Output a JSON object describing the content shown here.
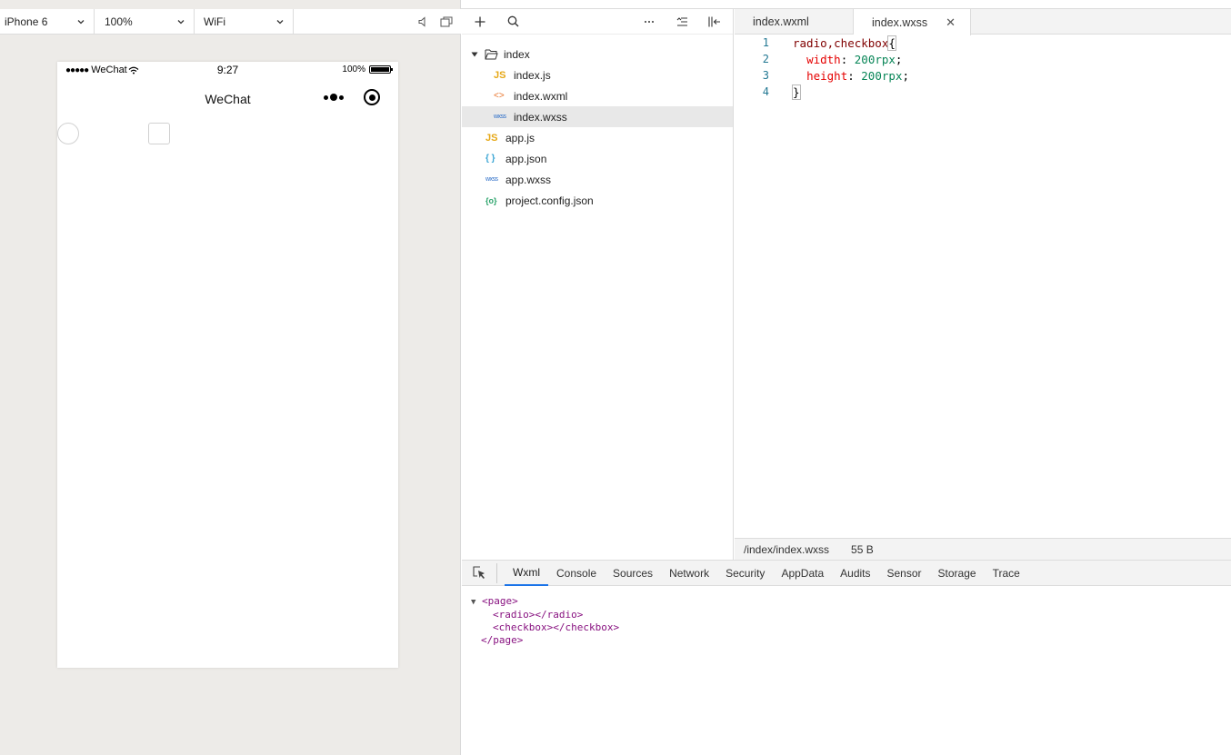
{
  "simulator": {
    "device": "iPhone 6",
    "zoom": "100%",
    "network": "WiFi",
    "phone": {
      "status_dots": "●●●●●",
      "status_carrier": "WeChat",
      "time": "9:27",
      "battery": "100%",
      "nav_title": "WeChat"
    }
  },
  "explorer": {
    "folder": "index",
    "files": [
      {
        "icon": "JS",
        "name": "index.js",
        "type": "js"
      },
      {
        "icon": "<>",
        "name": "index.wxml",
        "type": "wxml"
      },
      {
        "icon": "wxss",
        "name": "index.wxss",
        "type": "wxss"
      }
    ],
    "root_files": [
      {
        "icon": "JS",
        "name": "app.js",
        "type": "js"
      },
      {
        "icon": "{ }",
        "name": "app.json",
        "type": "json"
      },
      {
        "icon": "wxss",
        "name": "app.wxss",
        "type": "wxss"
      },
      {
        "icon": "{o}",
        "name": "project.config.json",
        "type": "config"
      }
    ]
  },
  "editor": {
    "tabs": [
      {
        "label": "index.wxml"
      },
      {
        "label": "index.wxss",
        "close": "✕"
      }
    ],
    "lines": [
      {
        "num": "1",
        "selector": "radio,checkbox",
        "brace": "{"
      },
      {
        "num": "2",
        "prop": "width",
        "colon": ": ",
        "value": "200rpx",
        "semi": ";"
      },
      {
        "num": "3",
        "prop": "height",
        "colon": ": ",
        "value": "200rpx",
        "semi": ";"
      },
      {
        "num": "4",
        "brace": "}"
      }
    ],
    "status_path": "/index/index.wxss",
    "status_size": "55 B"
  },
  "debugger": {
    "tabs": [
      "Wxml",
      "Console",
      "Sources",
      "Network",
      "Security",
      "AppData",
      "Audits",
      "Sensor",
      "Storage",
      "Trace"
    ],
    "active_tab": "Wxml",
    "dom": {
      "page_open": "<page>",
      "radio": "<radio></radio>",
      "checkbox": "<checkbox></checkbox>",
      "page_close": "</page>"
    }
  }
}
